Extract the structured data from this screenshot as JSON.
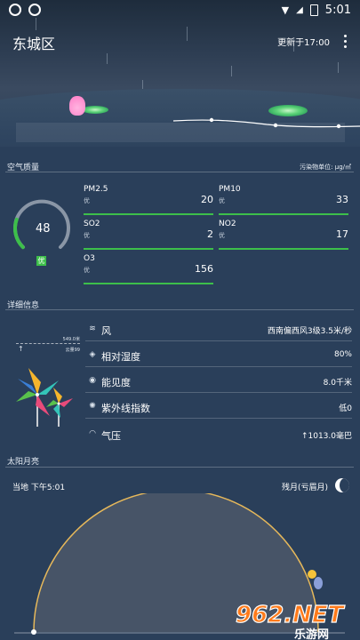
{
  "status_bar": {
    "time": "5:01"
  },
  "header": {
    "city": "东城区",
    "update_time": "更新于17:00"
  },
  "air_quality": {
    "title": "空气质量",
    "unit_label": "污染物单位: μg/㎡",
    "aqi": "48",
    "aqi_fraction": 0.24,
    "level": "优",
    "pollutants": [
      {
        "name": "PM2.5",
        "level": "优",
        "value": "20"
      },
      {
        "name": "PM10",
        "level": "优",
        "value": "33"
      },
      {
        "name": "SO2",
        "level": "优",
        "value": "2"
      },
      {
        "name": "NO2",
        "level": "优",
        "value": "17"
      },
      {
        "name": "O3",
        "level": "优",
        "value": "156"
      }
    ]
  },
  "details": {
    "title": "详细信息",
    "wind_marker_top": "549.0米",
    "wind_marker_bottom": "云量99",
    "rows": [
      {
        "icon": "wind-icon",
        "label": "风",
        "value": "西南偏西风3级3.5米/秒"
      },
      {
        "icon": "humidity-icon",
        "label": "相对湿度",
        "value": "80%"
      },
      {
        "icon": "visibility-icon",
        "label": "能见度",
        "value": "8.0千米"
      },
      {
        "icon": "uv-icon",
        "label": "紫外线指数",
        "value": "低0"
      },
      {
        "icon": "pressure-icon",
        "label": "气压",
        "value": "↑1013.0毫巴"
      }
    ]
  },
  "sun_moon": {
    "title": "太阳月亮",
    "local_time": "当地 下午5:01",
    "moon_phase": "残月(亏眉月)"
  },
  "watermark": {
    "text": "962.NET",
    "subtext": "乐游网"
  },
  "colors": {
    "accent_green": "#3dbf4a",
    "arc_gold": "#e6b85a",
    "background": "#2a3f5a"
  }
}
